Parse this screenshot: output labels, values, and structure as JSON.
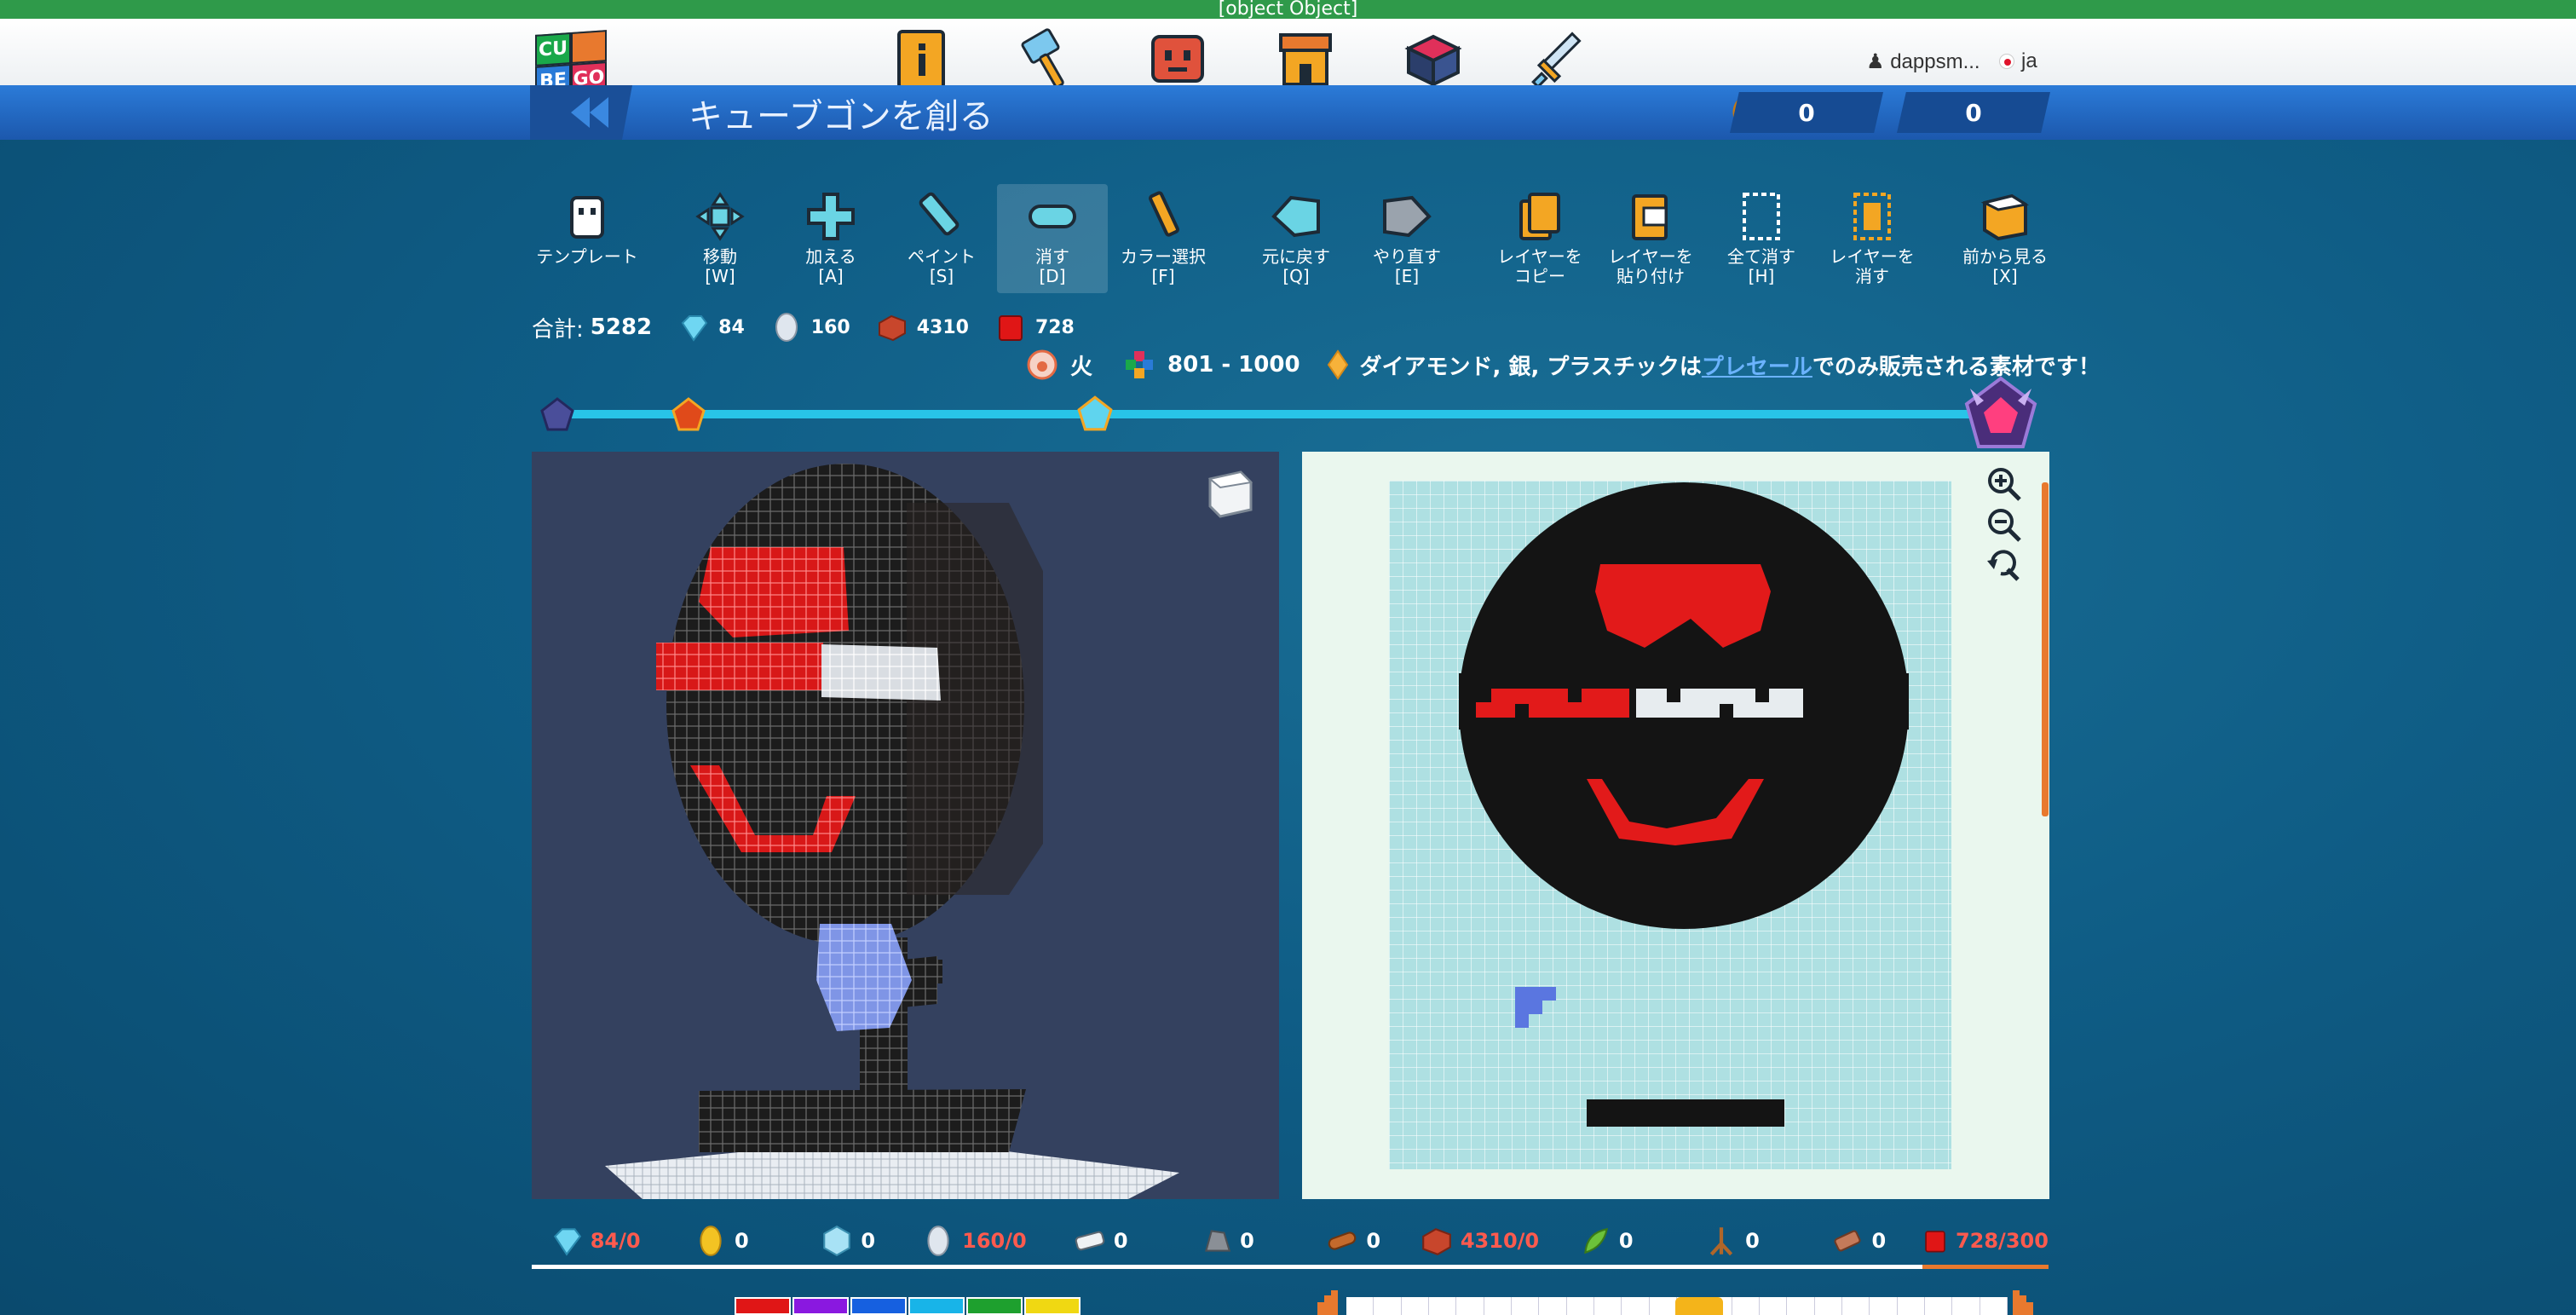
{
  "window_title": "[object Object]",
  "brand": {
    "logo_text": [
      "CU",
      "BE",
      "GO"
    ]
  },
  "nav_icons": [
    "info-card-icon",
    "hammer-icon",
    "robot-face-icon",
    "shop-icon",
    "treasure-chest-icon",
    "sword-icon"
  ],
  "user": {
    "name": "dappsm...",
    "lang": "ja"
  },
  "header": {
    "title": "キューブゴンを創る"
  },
  "currencies": [
    {
      "icon": "coin-icon",
      "value": "0"
    },
    {
      "icon": "crystal-icon",
      "value": "0"
    }
  ],
  "toolbar": [
    {
      "icon": "template-icon",
      "label": "テンプレート"
    },
    {
      "icon": "move-icon",
      "label": "移動\n[W]"
    },
    {
      "icon": "add-icon",
      "label": "加える\n[A]"
    },
    {
      "icon": "paint-icon",
      "label": "ペイント\n[S]"
    },
    {
      "icon": "erase-icon",
      "label": "消す\n[D]",
      "active": true
    },
    {
      "icon": "color-picker-icon",
      "label": "カラー選択\n[F]"
    },
    {
      "icon": "undo-icon",
      "label": "元に戻す\n[Q]"
    },
    {
      "icon": "redo-icon",
      "label": "やり直す\n[E]"
    },
    {
      "icon": "copy-layer-icon",
      "label": "レイヤーを\nコピー"
    },
    {
      "icon": "paste-layer-icon",
      "label": "レイヤーを\n貼り付け"
    },
    {
      "icon": "clear-all-icon",
      "label": "全て消す\n[H]"
    },
    {
      "icon": "clear-layer-icon",
      "label": "レイヤーを\n消す"
    },
    {
      "icon": "front-view-icon",
      "label": "前から見る\n[X]"
    }
  ],
  "totals": {
    "label": "合計:",
    "total": "5282",
    "materials": [
      {
        "icon": "diamond-icon",
        "value": "84"
      },
      {
        "icon": "silver-icon",
        "value": "160"
      },
      {
        "icon": "brick-icon",
        "value": "4310"
      },
      {
        "icon": "plastic-icon",
        "value": "728"
      }
    ]
  },
  "info": {
    "element": "火",
    "range": "801 - 1000",
    "notice_pre": "ダイアモンド, 銀, プラスチックは",
    "notice_link": "プレセール",
    "notice_post": "でのみ販売される素材です！"
  },
  "tier_progress": {
    "value": 0.37,
    "tiers": [
      "tier-1-gem-icon",
      "tier-2-gem-icon",
      "tier-3-gem-icon",
      "tier-4-crown-icon"
    ]
  },
  "materials_bar": [
    {
      "icon": "diamond-icon",
      "count": "84/0",
      "over": true
    },
    {
      "icon": "gold-icon",
      "count": "0",
      "over": false
    },
    {
      "icon": "ice-icon",
      "count": "0",
      "over": false
    },
    {
      "icon": "silver-icon",
      "count": "160/0",
      "over": true
    },
    {
      "icon": "iron-icon",
      "count": "0",
      "over": false
    },
    {
      "icon": "stone-icon",
      "count": "0",
      "over": false
    },
    {
      "icon": "wood-icon",
      "count": "0",
      "over": false
    },
    {
      "icon": "brick-icon",
      "count": "4310/0",
      "over": true
    },
    {
      "icon": "plant-icon",
      "count": "0",
      "over": false
    },
    {
      "icon": "root-icon",
      "count": "0",
      "over": false
    },
    {
      "icon": "leather-icon",
      "count": "0",
      "over": false
    },
    {
      "icon": "plastic-icon",
      "count": "728/300",
      "over": true
    }
  ],
  "palette": [
    "#e01616",
    "#8a18e0",
    "#1660e0",
    "#18b4e8",
    "#1ea02e",
    "#f0d812"
  ],
  "colors": {
    "accent_orange": "#e8792e",
    "over_limit_red": "#ff5a4e",
    "active_tool_bg": "#4a7fa0"
  }
}
